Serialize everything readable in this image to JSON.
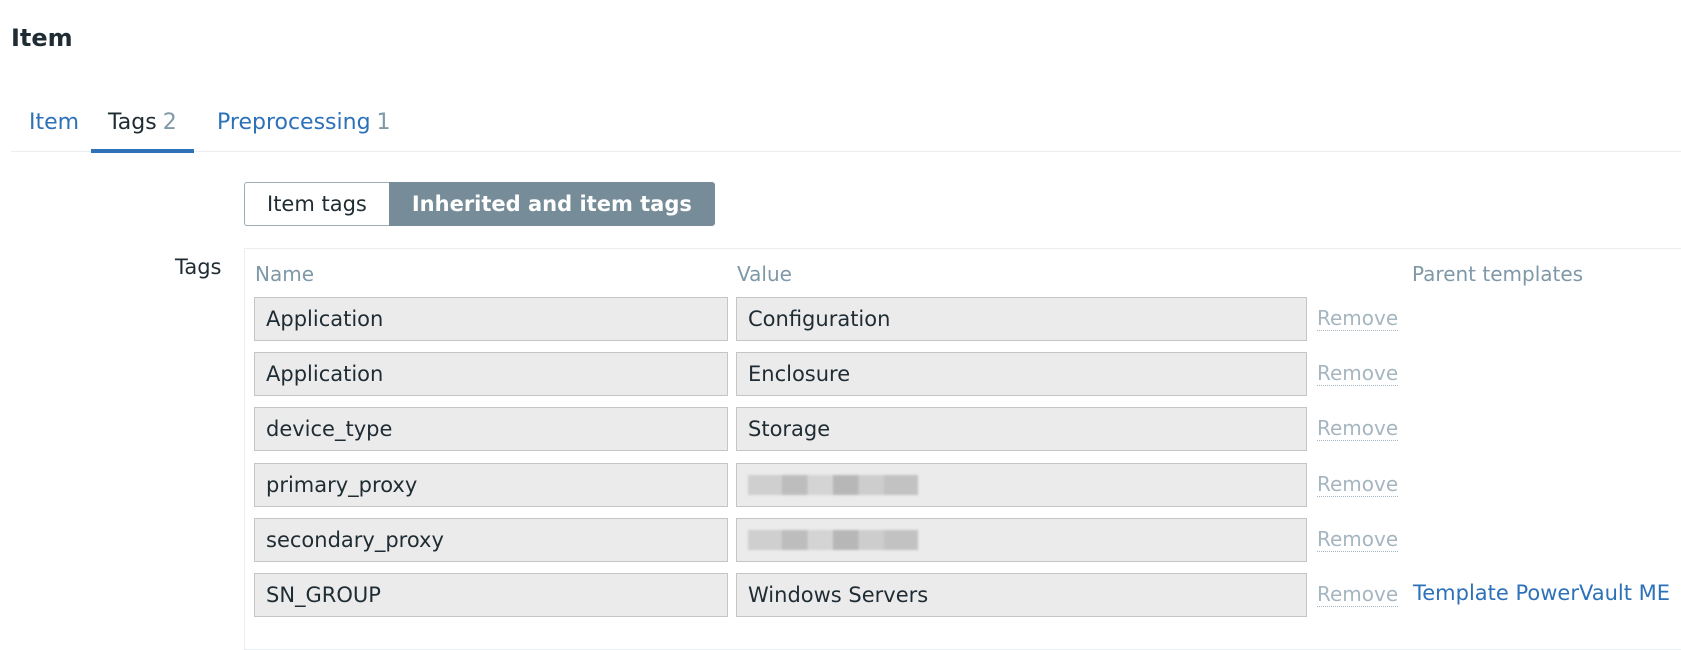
{
  "page": {
    "title": "Item"
  },
  "tabs": [
    {
      "label": "Item",
      "count": ""
    },
    {
      "label": "Tags",
      "count": "2"
    },
    {
      "label": "Preprocessing",
      "count": "1"
    }
  ],
  "toggle": {
    "item_tags": "Item tags",
    "inherited_tags": "Inherited and item tags"
  },
  "tags": {
    "label": "Tags",
    "headers": {
      "name": "Name",
      "value": "Value",
      "parent": "Parent templates"
    },
    "rows": [
      {
        "name": "Application",
        "value": "Configuration",
        "remove": "Remove",
        "parent": ""
      },
      {
        "name": "Application",
        "value": "Enclosure",
        "remove": "Remove",
        "parent": ""
      },
      {
        "name": "device_type",
        "value": "Storage",
        "remove": "Remove",
        "parent": ""
      },
      {
        "name": "primary_proxy",
        "value": "",
        "remove": "Remove",
        "parent": ""
      },
      {
        "name": "secondary_proxy",
        "value": "",
        "remove": "Remove",
        "parent": ""
      },
      {
        "name": "SN_GROUP",
        "value": "Windows Servers",
        "remove": "Remove",
        "parent": "Template PowerVault ME"
      }
    ]
  }
}
